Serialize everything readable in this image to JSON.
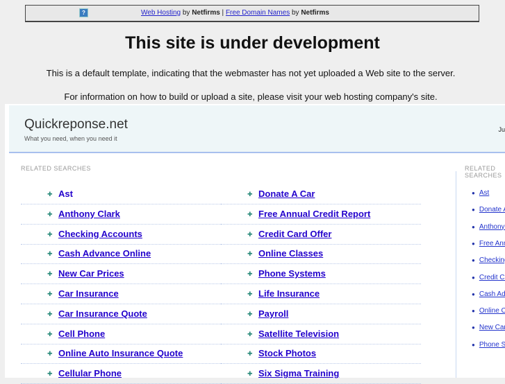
{
  "topbar": {
    "link1": "Web Hosting",
    "by1": " by ",
    "brand1": "Netfirms",
    "sep": " | ",
    "link2": "Free Domain Names",
    "by2": " by ",
    "brand2": "Netfirms",
    "icon": "help-icon"
  },
  "heading": "This site is under development",
  "message1": "This is a default template, indicating that the webmaster has not yet uploaded a Web site to the server.",
  "message2": "For information on how to build or upload a site, please visit your web hosting company's site.",
  "site": {
    "name": "Quickreponse.net",
    "tagline": "What you need, when you need it",
    "right_text": "Ju"
  },
  "related_label": "RELATED SEARCHES",
  "sidebar_label": "RELATED SEARCHES",
  "col1": [
    "Ast",
    "Anthony Clark",
    "Checking Accounts",
    "Cash Advance Online",
    "New Car Prices",
    "Car Insurance",
    "Car Insurance Quote",
    "Cell Phone",
    "Online Auto Insurance Quote",
    "Cellular Phone"
  ],
  "col2": [
    "Donate A Car",
    "Free Annual Credit Report",
    "Credit Card Offer",
    "Online Classes",
    "Phone Systems",
    "Life Insurance",
    "Payroll",
    "Satellite Television",
    "Stock Photos",
    "Six Sigma Training"
  ],
  "sidebar": [
    "Ast",
    "Donate A Car",
    "Anthony Clark",
    "Free Annual Credit Report",
    "Checking Accounts",
    "Credit Card Offer",
    "Cash Advance Online",
    "Online Classes",
    "New Car Prices",
    "Phone Systems"
  ],
  "colors": {
    "link": "#2200cc",
    "header_bg": "#eef6f8"
  }
}
